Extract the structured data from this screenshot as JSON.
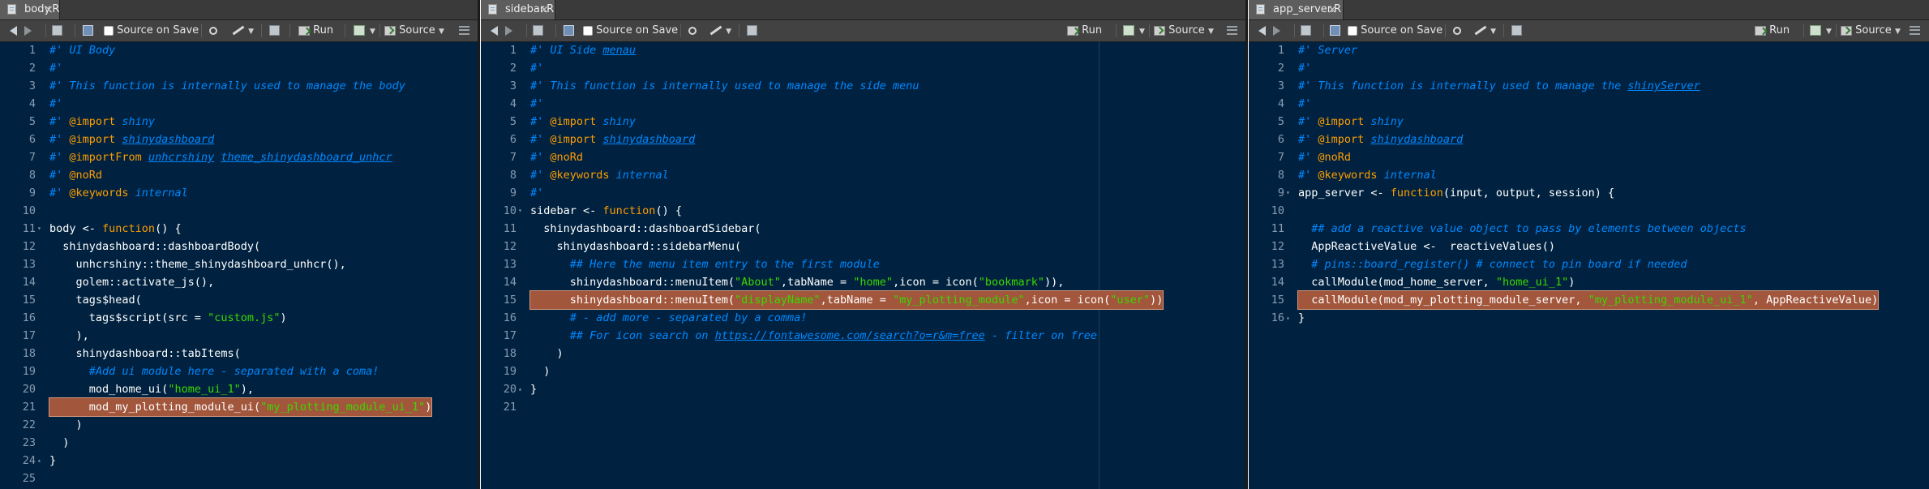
{
  "toolbar": {
    "source_on_save": "Source on Save",
    "run": "Run",
    "source": "Source"
  },
  "panes": [
    {
      "tab": "body.R",
      "lines": [
        {
          "n": "1",
          "fold": "",
          "segs": [
            [
              "c",
              "#' UI Body"
            ]
          ]
        },
        {
          "n": "2",
          "fold": "",
          "segs": [
            [
              "c",
              "#'"
            ]
          ]
        },
        {
          "n": "3",
          "fold": "",
          "segs": [
            [
              "c",
              "#' This function is internally used to manage the body"
            ]
          ]
        },
        {
          "n": "4",
          "fold": "",
          "segs": [
            [
              "c",
              "#'"
            ]
          ]
        },
        {
          "n": "5",
          "fold": "",
          "segs": [
            [
              "c",
              "#' "
            ],
            [
              "r",
              "@import"
            ],
            [
              "c",
              " shiny"
            ]
          ]
        },
        {
          "n": "6",
          "fold": "",
          "segs": [
            [
              "c",
              "#' "
            ],
            [
              "r",
              "@import"
            ],
            [
              "c",
              " "
            ],
            [
              "u",
              "shinydashboard"
            ]
          ]
        },
        {
          "n": "7",
          "fold": "",
          "segs": [
            [
              "c",
              "#' "
            ],
            [
              "r",
              "@importFrom"
            ],
            [
              "c",
              " "
            ],
            [
              "u",
              "unhcrshiny"
            ],
            [
              "c",
              " "
            ],
            [
              "u",
              "theme_shinydashboard_unhcr"
            ]
          ]
        },
        {
          "n": "8",
          "fold": "",
          "segs": [
            [
              "c",
              "#' "
            ],
            [
              "r",
              "@noRd"
            ]
          ]
        },
        {
          "n": "9",
          "fold": "",
          "segs": [
            [
              "c",
              "#' "
            ],
            [
              "r",
              "@keywords"
            ],
            [
              "c",
              " internal"
            ]
          ]
        },
        {
          "n": "10",
          "fold": "",
          "segs": []
        },
        {
          "n": "11",
          "fold": "▾",
          "segs": [
            [
              "t",
              "body <- "
            ],
            [
              "r",
              "function"
            ],
            [
              "t",
              "() {"
            ]
          ]
        },
        {
          "n": "12",
          "fold": "",
          "segs": [
            [
              "t",
              "  shinydashboard::dashboardBody("
            ]
          ]
        },
        {
          "n": "13",
          "fold": "",
          "segs": [
            [
              "t",
              "    unhcrshiny::theme_shinydashboard_unhcr(),"
            ]
          ]
        },
        {
          "n": "14",
          "fold": "",
          "segs": [
            [
              "t",
              "    golem::activate_js(),"
            ]
          ]
        },
        {
          "n": "15",
          "fold": "",
          "segs": [
            [
              "t",
              "    tags$head("
            ]
          ]
        },
        {
          "n": "16",
          "fold": "",
          "segs": [
            [
              "t",
              "      tags$script(src = "
            ],
            [
              "s",
              "\"custom.js\""
            ],
            [
              "t",
              ")"
            ]
          ]
        },
        {
          "n": "17",
          "fold": "",
          "segs": [
            [
              "t",
              "    ),"
            ]
          ]
        },
        {
          "n": "18",
          "fold": "",
          "segs": [
            [
              "t",
              "    shinydashboard::tabItems("
            ]
          ]
        },
        {
          "n": "19",
          "fold": "",
          "segs": [
            [
              "c",
              "      #Add ui module here - separated with a coma!"
            ]
          ]
        },
        {
          "n": "20",
          "fold": "",
          "segs": [
            [
              "t",
              "      mod_home_ui("
            ],
            [
              "s",
              "\"home_ui_1\""
            ],
            [
              "t",
              "),"
            ]
          ]
        },
        {
          "n": "21",
          "fold": "",
          "hl": true,
          "segs": [
            [
              "t",
              "      mod_my_plotting_module_ui("
            ],
            [
              "s",
              "\"my_plotting_module_ui_1\""
            ],
            [
              "t",
              ")"
            ]
          ]
        },
        {
          "n": "22",
          "fold": "",
          "segs": [
            [
              "t",
              "    )"
            ]
          ]
        },
        {
          "n": "23",
          "fold": "",
          "segs": [
            [
              "t",
              "  )"
            ]
          ]
        },
        {
          "n": "24",
          "fold": "▴",
          "segs": [
            [
              "t",
              "}"
            ]
          ]
        },
        {
          "n": "25",
          "fold": "",
          "segs": []
        }
      ]
    },
    {
      "tab": "sidebar.R",
      "lines": [
        {
          "n": "1",
          "fold": "",
          "segs": [
            [
              "c",
              "#' UI Side "
            ],
            [
              "u",
              "menau"
            ]
          ]
        },
        {
          "n": "2",
          "fold": "",
          "segs": [
            [
              "c",
              "#'"
            ]
          ]
        },
        {
          "n": "3",
          "fold": "",
          "segs": [
            [
              "c",
              "#' This function is internally used to manage the side menu"
            ]
          ]
        },
        {
          "n": "4",
          "fold": "",
          "segs": [
            [
              "c",
              "#'"
            ]
          ]
        },
        {
          "n": "5",
          "fold": "",
          "segs": [
            [
              "c",
              "#' "
            ],
            [
              "r",
              "@import"
            ],
            [
              "c",
              " shiny"
            ]
          ]
        },
        {
          "n": "6",
          "fold": "",
          "segs": [
            [
              "c",
              "#' "
            ],
            [
              "r",
              "@import"
            ],
            [
              "c",
              " "
            ],
            [
              "u",
              "shinydashboard"
            ]
          ]
        },
        {
          "n": "7",
          "fold": "",
          "segs": [
            [
              "c",
              "#' "
            ],
            [
              "r",
              "@noRd"
            ]
          ]
        },
        {
          "n": "8",
          "fold": "",
          "segs": [
            [
              "c",
              "#' "
            ],
            [
              "r",
              "@keywords"
            ],
            [
              "c",
              " internal"
            ]
          ]
        },
        {
          "n": "9",
          "fold": "",
          "segs": [
            [
              "c",
              "#'"
            ]
          ]
        },
        {
          "n": "10",
          "fold": "▾",
          "segs": [
            [
              "t",
              "sidebar <- "
            ],
            [
              "r",
              "function"
            ],
            [
              "t",
              "() {"
            ]
          ]
        },
        {
          "n": "11",
          "fold": "",
          "segs": [
            [
              "t",
              "  shinydashboard::dashboardSidebar("
            ]
          ]
        },
        {
          "n": "12",
          "fold": "",
          "segs": [
            [
              "t",
              "    shinydashboard::sidebarMenu("
            ]
          ]
        },
        {
          "n": "13",
          "fold": "",
          "segs": [
            [
              "c",
              "      ## Here the menu item entry to the first module"
            ]
          ]
        },
        {
          "n": "14",
          "fold": "",
          "segs": [
            [
              "t",
              "      shinydashboard::menuItem("
            ],
            [
              "s",
              "\"About\""
            ],
            [
              "t",
              ",tabName = "
            ],
            [
              "s",
              "\"home\""
            ],
            [
              "t",
              ",icon = icon("
            ],
            [
              "s",
              "\"bookmark\""
            ],
            [
              "t",
              ")),"
            ]
          ]
        },
        {
          "n": "15",
          "fold": "",
          "hl": true,
          "segs": [
            [
              "t",
              "      shinydashboard::menuItem("
            ],
            [
              "s",
              "\"displayName\""
            ],
            [
              "t",
              ",tabName = "
            ],
            [
              "s",
              "\"my_plotting_module\""
            ],
            [
              "t",
              ",icon = icon("
            ],
            [
              "s",
              "\"user\""
            ],
            [
              "t",
              "))"
            ]
          ]
        },
        {
          "n": "16",
          "fold": "",
          "segs": [
            [
              "c",
              "      # - add more - separated by a comma!"
            ]
          ]
        },
        {
          "n": "17",
          "fold": "",
          "segs": [
            [
              "c",
              "      ## For icon search on "
            ],
            [
              "u",
              "https://fontawesome.com/search?o=r&m=free"
            ],
            [
              "c",
              " - filter on free"
            ]
          ]
        },
        {
          "n": "18",
          "fold": "",
          "segs": [
            [
              "t",
              "    )"
            ]
          ]
        },
        {
          "n": "19",
          "fold": "",
          "segs": [
            [
              "t",
              "  )"
            ]
          ]
        },
        {
          "n": "20",
          "fold": "▴",
          "segs": [
            [
              "t",
              "}"
            ]
          ]
        },
        {
          "n": "21",
          "fold": "",
          "segs": []
        }
      ]
    },
    {
      "tab": "app_server.R",
      "lines": [
        {
          "n": "1",
          "fold": "",
          "segs": [
            [
              "c",
              "#' Server"
            ]
          ]
        },
        {
          "n": "2",
          "fold": "",
          "segs": [
            [
              "c",
              "#'"
            ]
          ]
        },
        {
          "n": "3",
          "fold": "",
          "segs": [
            [
              "c",
              "#' This function is internally used to manage the "
            ],
            [
              "u",
              "shinyServer"
            ]
          ]
        },
        {
          "n": "4",
          "fold": "",
          "segs": [
            [
              "c",
              "#'"
            ]
          ]
        },
        {
          "n": "5",
          "fold": "",
          "segs": [
            [
              "c",
              "#' "
            ],
            [
              "r",
              "@import"
            ],
            [
              "c",
              " shiny"
            ]
          ]
        },
        {
          "n": "6",
          "fold": "",
          "segs": [
            [
              "c",
              "#' "
            ],
            [
              "r",
              "@import"
            ],
            [
              "c",
              " "
            ],
            [
              "u",
              "shinydashboard"
            ]
          ]
        },
        {
          "n": "7",
          "fold": "",
          "segs": [
            [
              "c",
              "#' "
            ],
            [
              "r",
              "@noRd"
            ]
          ]
        },
        {
          "n": "8",
          "fold": "",
          "segs": [
            [
              "c",
              "#' "
            ],
            [
              "r",
              "@keywords"
            ],
            [
              "c",
              " internal"
            ]
          ]
        },
        {
          "n": "9",
          "fold": "▾",
          "segs": [
            [
              "t",
              "app_server <- "
            ],
            [
              "r",
              "function"
            ],
            [
              "t",
              "(input, output, session) {"
            ]
          ]
        },
        {
          "n": "10",
          "fold": "",
          "segs": []
        },
        {
          "n": "11",
          "fold": "",
          "segs": [
            [
              "c",
              "  ## add a reactive value object to pass by elements between objects"
            ]
          ]
        },
        {
          "n": "12",
          "fold": "",
          "segs": [
            [
              "t",
              "  AppReactiveValue <-  reactiveValues()"
            ]
          ]
        },
        {
          "n": "13",
          "fold": "",
          "segs": [
            [
              "c",
              "  # pins::board_register() # connect to pin board if needed"
            ]
          ]
        },
        {
          "n": "14",
          "fold": "",
          "segs": [
            [
              "t",
              "  callModule(mod_home_server, "
            ],
            [
              "s",
              "\"home_ui_1\""
            ],
            [
              "t",
              ")"
            ]
          ]
        },
        {
          "n": "15",
          "fold": "",
          "hl": true,
          "segs": [
            [
              "t",
              "  callModule(mod_my_plotting_module_server, "
            ],
            [
              "s",
              "\"my_plotting_module_ui_1\""
            ],
            [
              "t",
              ", AppReactiveValue)"
            ]
          ]
        },
        {
          "n": "16",
          "fold": "▴",
          "segs": [
            [
              "t",
              "}"
            ]
          ]
        }
      ]
    }
  ]
}
